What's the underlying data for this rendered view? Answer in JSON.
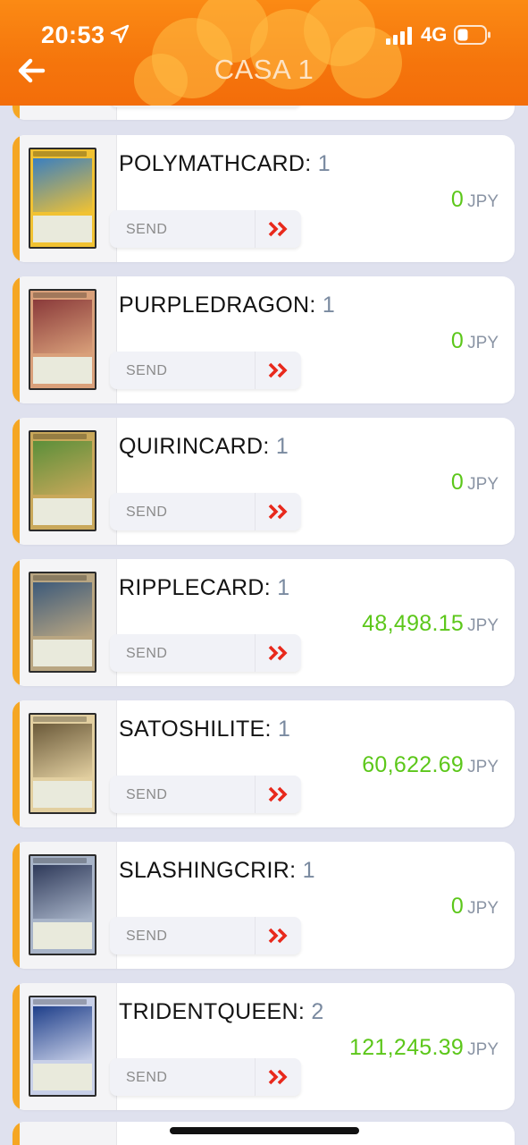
{
  "status_bar": {
    "time": "20:53",
    "network": "4G",
    "icons": [
      "location-arrow-icon",
      "signal-icon",
      "battery-icon"
    ]
  },
  "header": {
    "title": "CASA 1",
    "back_icon": "arrow-left-icon",
    "color": "#f5750c"
  },
  "colors": {
    "accent": "#f5a623",
    "value_green": "#5cc71a",
    "send_arrow_red": "#e8291c"
  },
  "cards": [
    {
      "name": "POLYMATHCARD",
      "qty": "1",
      "amount": "0",
      "currency": "JPY",
      "send_label": "SEND",
      "art": [
        "#3a7fc0",
        "#f1c232"
      ]
    },
    {
      "name": "PURPLEDRAGON",
      "qty": "1",
      "amount": "0",
      "currency": "JPY",
      "send_label": "SEND",
      "art": [
        "#8a3a3a",
        "#d9a07a"
      ]
    },
    {
      "name": "QUIRINCARD",
      "qty": "1",
      "amount": "0",
      "currency": "JPY",
      "send_label": "SEND",
      "art": [
        "#5b8f3a",
        "#c9a85a"
      ]
    },
    {
      "name": "RIPPLECARD",
      "qty": "1",
      "amount": "48,498.15",
      "currency": "JPY",
      "send_label": "SEND",
      "art": [
        "#3d5a7a",
        "#b9a682"
      ]
    },
    {
      "name": "SATOSHILITE",
      "qty": "1",
      "amount": "60,622.69",
      "currency": "JPY",
      "send_label": "SEND",
      "art": [
        "#6b5a3a",
        "#e2cfa0"
      ]
    },
    {
      "name": "SLASHINGCRIR",
      "qty": "1",
      "amount": "0",
      "currency": "JPY",
      "send_label": "SEND",
      "art": [
        "#2f3a5a",
        "#a8b4c8"
      ]
    },
    {
      "name": "TRIDENTQUEEN",
      "qty": "2",
      "amount": "121,245.39",
      "currency": "JPY",
      "send_label": "SEND",
      "art": [
        "#1f3f8a",
        "#c8d0e8"
      ]
    }
  ]
}
